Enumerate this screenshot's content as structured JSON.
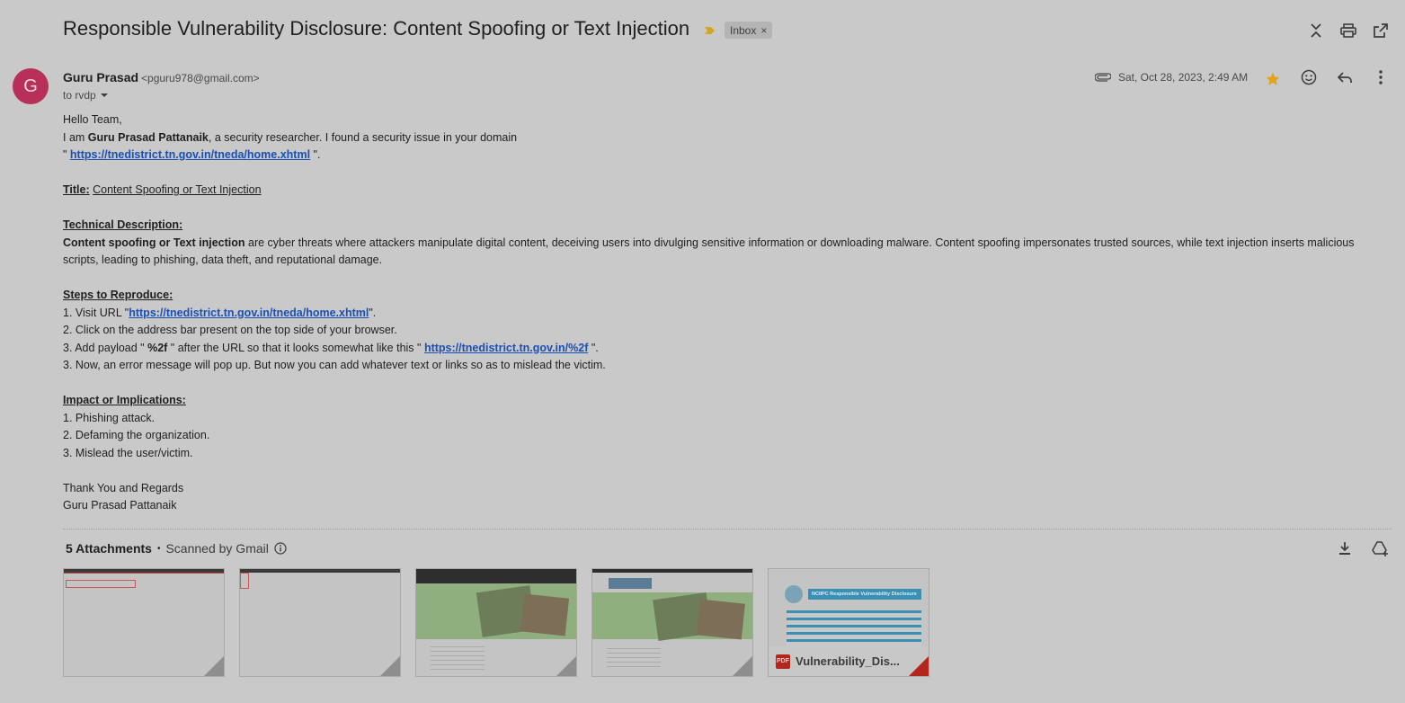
{
  "header": {
    "subject": "Responsible Vulnerability Disclosure: Content Spoofing or Text Injection",
    "label": "Inbox",
    "label_close": "×",
    "icons": [
      "collapse-icon",
      "print-icon",
      "open-in-new-window-icon"
    ]
  },
  "message": {
    "avatar_letter": "G",
    "sender_name": "Guru Prasad",
    "sender_email": "<pguru978@gmail.com>",
    "to": "to rvdp",
    "date": "Sat, Oct 28, 2023, 2:49 AM",
    "starred": true,
    "icons": [
      "attachment-icon",
      "star-icon",
      "emoji-icon",
      "reply-icon",
      "more-vert-icon"
    ]
  },
  "body": {
    "greeting": "Hello Team,",
    "intro_pre": "I am ",
    "intro_name": "Guru Prasad Pattanaik",
    "intro_post": ", a security researcher. I found a security issue in your domain",
    "domain_quote_open": "\" ",
    "domain_link": "https://tnedistrict.tn.gov.in/tneda/home.xhtml",
    "domain_quote_close": " \".",
    "title_label": "Title:",
    "title_value": "Content Spoofing or Text Injection",
    "tech_heading": "Technical Description:",
    "tech_bold": "Content spoofing or Text injection",
    "tech_rest": " are cyber threats where attackers manipulate digital content, deceiving users into divulging sensitive information or downloading malware. Content spoofing impersonates trusted sources, while text injection inserts malicious scripts, leading to phishing, data theft, and reputational damage.",
    "steps_heading": "Steps to Reproduce:",
    "step1_pre": "1. Visit URL \"",
    "step1_link": "https://tnedistrict.tn.gov.in/tneda/home.xhtml",
    "step1_post": "\".",
    "step2": "2. Click on the address bar present on the top side of your browser.",
    "step3_pre": "3. Add payload \" ",
    "step3_payload": "%2f",
    "step3_mid": " \" after the URL so that it looks somewhat like this \" ",
    "step3_link": "https://tnedistrict.tn.gov.in/%2f",
    "step3_post": " \".",
    "step4": "3. Now, an error message will pop up. But now you can add whatever text or links so as to mislead the victim.",
    "impact_heading": "Impact or Implications:",
    "impact1": "1. Phishing attack.",
    "impact2": "2. Defaming the organization.",
    "impact3": "3. Mislead the user/victim.",
    "signoff": "Thank You and Regards",
    "signature": "Guru Prasad Pattanaik"
  },
  "attachments": {
    "count_label": "5 Attachments",
    "separator": "•",
    "scanned_label": "Scanned by Gmail",
    "items": [
      {
        "type": "image",
        "kind": "error-page-screenshot"
      },
      {
        "type": "image",
        "kind": "error-page-screenshot"
      },
      {
        "type": "image",
        "kind": "website-screenshot"
      },
      {
        "type": "image",
        "kind": "website-screenshot"
      },
      {
        "type": "pdf",
        "name": "Vulnerability_Dis...",
        "badge": "PDF",
        "preview_title": "NCIIPC Responsible Vulnerability Disclosure"
      }
    ],
    "icons": [
      "download-all-icon",
      "add-to-drive-icon"
    ]
  },
  "colors": {
    "background": "#c9c9c9",
    "avatar": "#b8305a",
    "link": "#1a4fb4",
    "star": "#e2a21a",
    "label_arrow": "#d6a520",
    "pdf": "#b3261e"
  }
}
